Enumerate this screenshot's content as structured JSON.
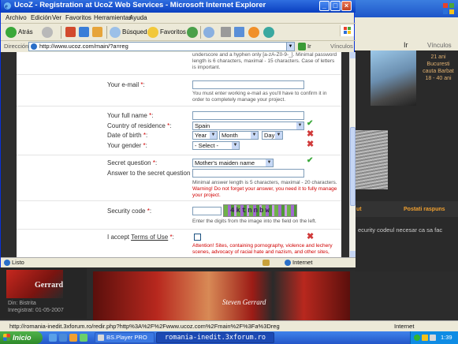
{
  "background_window": {
    "ir": "Ir",
    "links": "Vínculos",
    "profile_text": "21 ani\nBucuresti\ncauta Barbat\n18 - 40 ani",
    "postati_label": "Postati raspuns",
    "ut_label": "ut",
    "security_text": "ecurity codeul necesar ca sa fac",
    "avatar_name": "Gerrard",
    "din_text": "Din: Bistrita\nInregistrat: 01-05-2007",
    "banner_text": "Steven Gerrard",
    "status_url": "http://romania-inedit.3xforum.ro/redir.php?http%3A%2F%2Fwww.ucoz.com%2Fmain%2F%3Fa%3Dreg",
    "status_zone": "Internet"
  },
  "ie": {
    "title": "UcoZ - Registration at UcoZ Web Services - Microsoft Internet Explorer",
    "menu": [
      "Archivo",
      "Edición",
      "Ver",
      "Favoritos",
      "Herramientas",
      "Ayuda"
    ],
    "toolbar": {
      "back": "Atrás",
      "search": "Búsqueda",
      "favorites": "Favoritos"
    },
    "address": {
      "label": "Dirección",
      "url": "http://www.ucoz.com/main/?a=reg",
      "go": "Ir",
      "links": "Vínculos"
    },
    "status": {
      "text": "Listo",
      "zone": "Internet"
    }
  },
  "form": {
    "password_hint_top": "underscore and a hyphen only [a-zA-Z0-9-_]. Minimal password length is 6 characters, maximal - 15 characters. Case of letters is important.",
    "email_label": "Your e-mail",
    "email_value": "",
    "email_hint": "You must enter working e-mail as you'll have to confirm it in order to completely manage your project.",
    "fullname_label": "Your full name",
    "fullname_value": "",
    "country_label": "Country of residence",
    "country_value": "Spain",
    "dob_label": "Date of birth",
    "dob_year": "Year",
    "dob_month": "Month",
    "dob_day": "Day",
    "gender_label": "Your gender",
    "gender_value": "- Select -",
    "secret_q_label": "Secret question",
    "secret_q_value": "Mother's maiden name",
    "secret_a_label": "Answer to the secret question",
    "secret_a_value": "",
    "secret_a_hint": "Minimal answer length is 5 characters, maximal - 20 characters.",
    "secret_a_warning": "Warning! Do not forget your answer, you need it to fully manage your project.",
    "security_label": "Security code",
    "security_value": "",
    "captcha_text": "4ktnnbw",
    "security_hint": "Enter the digits from the image into the field on the left.",
    "terms_label_prefix": "I accept ",
    "terms_link": "Terms of Use",
    "terms_warning": "Attention! Sites, containing pornography, violence and lechery scenes, advocacy of racial hate and nazism, and other sites,",
    "required_mark": "*",
    "colon": ":"
  },
  "taskbar": {
    "start": "Inicio",
    "bsplayer": "BS.Player PRO",
    "ie_task": "romania-inedit.3xforum.ro",
    "clock": "1:39"
  },
  "colors": {
    "xp_blue": "#2457c9",
    "start_green": "#2e8a2a",
    "required_red": "#d00000",
    "ok_green": "#3aa83a",
    "error_red": "#d03a3a"
  }
}
